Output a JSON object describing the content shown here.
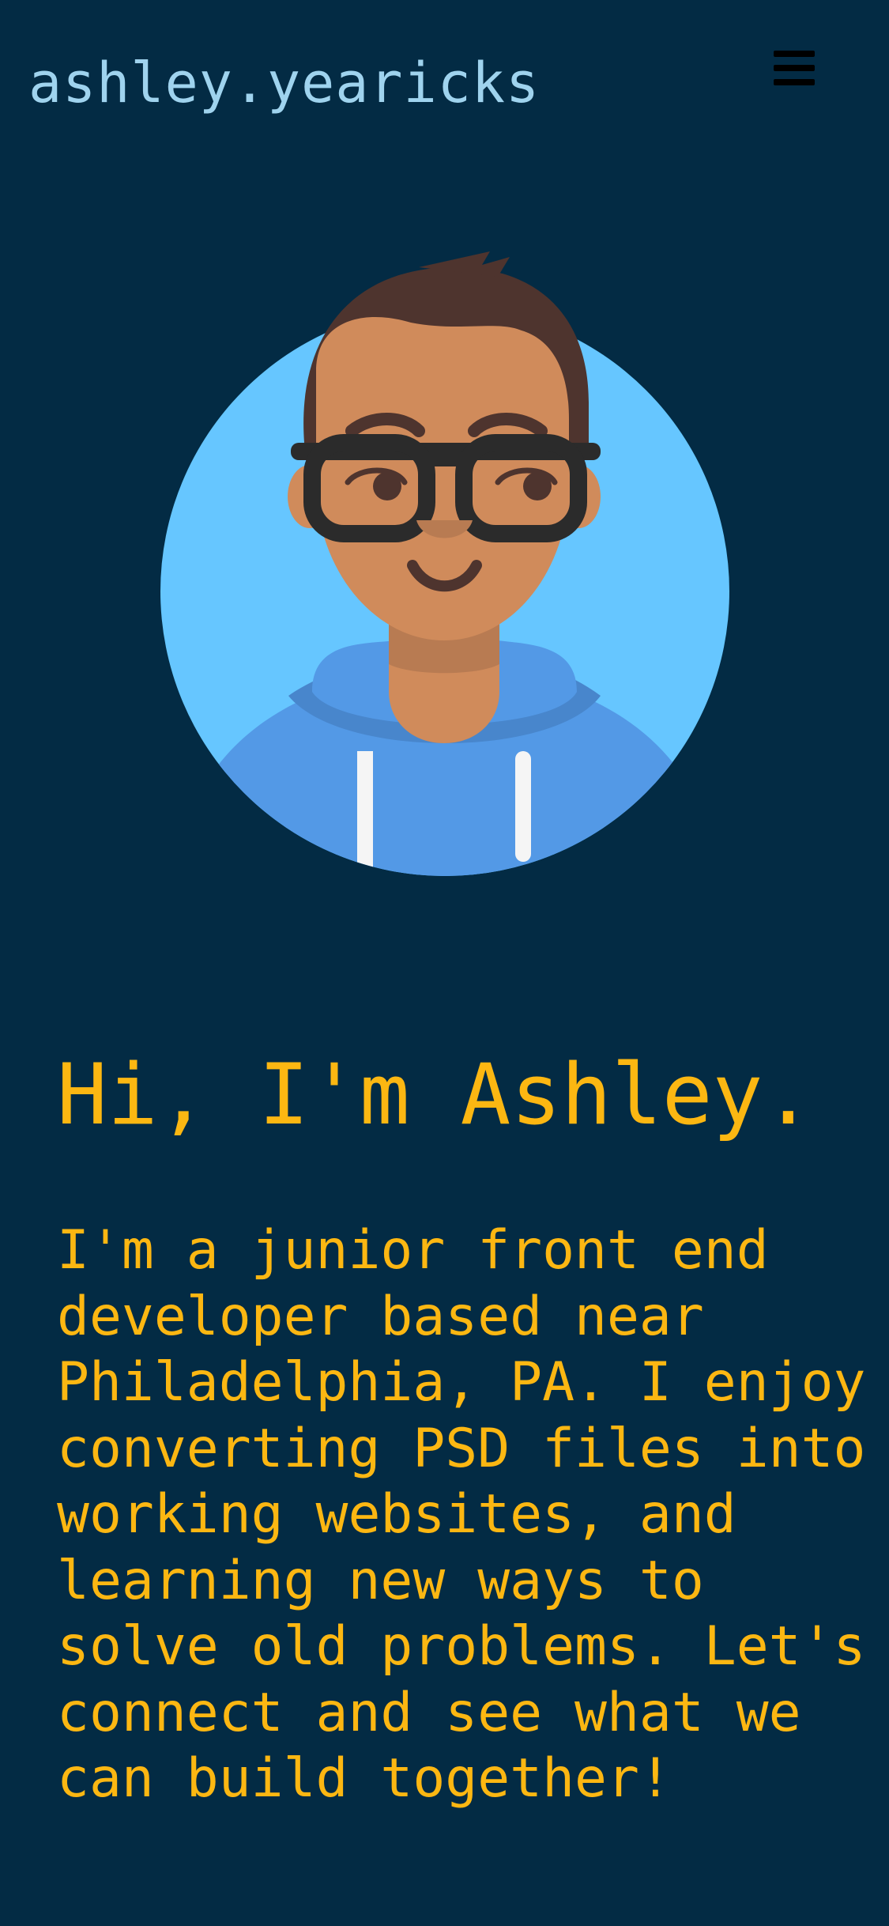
{
  "header": {
    "site_title": "ashley.yearicks",
    "menu_icon": "hamburger-menu-icon"
  },
  "hero": {
    "avatar_icon": "avatar-illustration",
    "colors": {
      "background": "#032b44",
      "accent": "#fcb712",
      "title": "#9fd3ee",
      "avatar_circle": "#66c6ff",
      "hoodie": "#5399e6"
    },
    "headline": "Hi, I'm Ashley.",
    "intro": "I'm a junior front end developer based near Philadelphia, PA. I enjoy converting PSD files into working websites, and learning new ways to solve old problems. Let's connect and see what we can build together!"
  }
}
